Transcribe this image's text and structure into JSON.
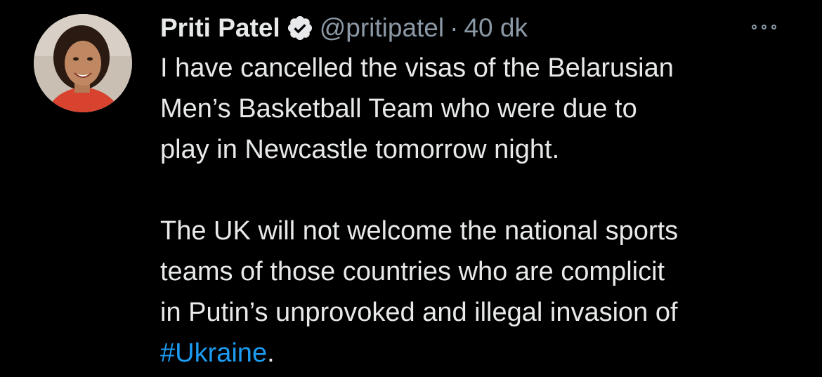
{
  "tweet": {
    "author_name": "Priti Patel",
    "handle": "@pritipatel",
    "separator": "·",
    "time": "40 dk",
    "body_lines": [
      "I have cancelled the visas of the Belarusian",
      "Men’s Basketball Team who were due to",
      "play in Newcastle tomorrow night.",
      "",
      "The UK will not welcome the national sports",
      "teams of those countries who are complicit",
      "in Putin’s unprovoked and illegal invasion of"
    ],
    "hashtag": "#Ukraine",
    "hashtag_suffix": "."
  },
  "colors": {
    "background": "#000000",
    "text": "#e7e9ea",
    "secondary": "#8b98a5",
    "link": "#1d9bf0"
  },
  "icons": {
    "verified": "verified-badge-icon",
    "more": "more-options-icon",
    "avatar": "profile-photo"
  }
}
